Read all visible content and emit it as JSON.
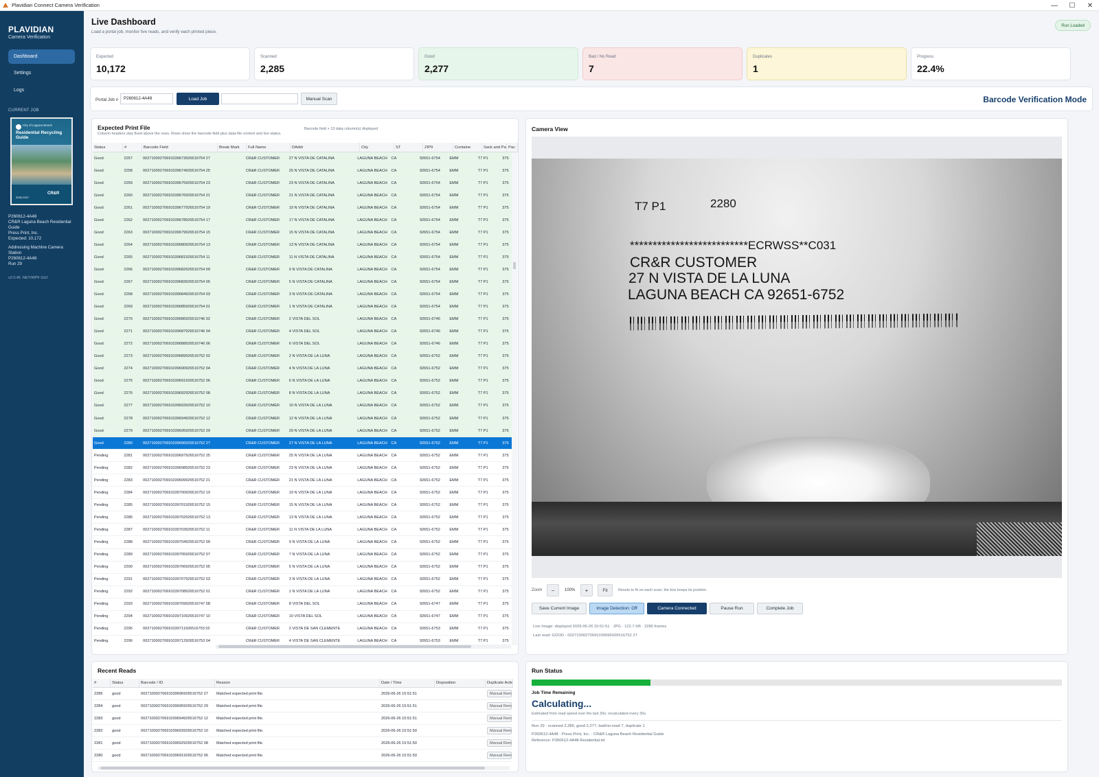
{
  "window": {
    "title": "Plavidian Connect Camera Verification",
    "controls": [
      "—",
      "☐",
      "✕"
    ]
  },
  "sidebar": {
    "brand": "PLAVIDIAN",
    "brand_sub": "Camera Verification",
    "nav": [
      {
        "label": "Dashboard"
      },
      {
        "label": "Settings"
      },
      {
        "label": "Logs"
      }
    ],
    "current_job_heading": "CURRENT JOB",
    "thumb": {
      "city": "City of Laguna Beach",
      "title": "Residential Recycling Guide",
      "years": "2026-2027",
      "crr": "CR&R"
    },
    "job_lines": [
      "P260612-4A48",
      "CR&R Laguna Beach Residential",
      "Guide",
      "Press Print, Inc.",
      "Expected: 10,172"
    ],
    "station_lines": [
      "Addressing Machine Camera",
      "Station",
      "P260612-4A48",
      "Run 29"
    ],
    "version": "v2.0.45 .NET/WPF GUI"
  },
  "header": {
    "title": "Live Dashboard",
    "subtitle": "Load a portal job, monitor live reads, and verify each printed piece.",
    "badge": "Run Loaded"
  },
  "stats": [
    {
      "label": "Expected",
      "value": "10,172",
      "bg": "#ffffff",
      "border": "#dfe3e8"
    },
    {
      "label": "Scanned",
      "value": "2,285",
      "bg": "#ffffff",
      "border": "#dfe3e8"
    },
    {
      "label": "Good",
      "value": "2,277",
      "bg": "#e7f6ea",
      "border": "#cfe8d5"
    },
    {
      "label": "Bad / No Read",
      "value": "7",
      "bg": "#fbe6e6",
      "border": "#f0cccc"
    },
    {
      "label": "Duplicates",
      "value": "1",
      "bg": "#fdf6d8",
      "border": "#ede0a8"
    },
    {
      "label": "Progress",
      "value": "22.4%",
      "bg": "#ffffff",
      "border": "#dfe3e8"
    }
  ],
  "job_bar": {
    "label": "Portal Job #",
    "job_value": "P260612-4A48",
    "load_label": "Load Job",
    "manual_value": "",
    "manual_scan_label": "Manual Scan",
    "mode": "Barcode Verification Mode"
  },
  "print_file": {
    "title": "Expected Print File",
    "subtitle": "Column headers stay fixed above the rows. Rows show the barcode field plus data-file context and live status.",
    "meta": "Barcode field + 13 data column(s) displayed",
    "columns": [
      "Status",
      "#",
      "Barcode Field",
      "Break Mark",
      "Full Name",
      "DAddr",
      "City",
      "ST",
      "ZIP9",
      "Containe",
      "Sack and Pa",
      "Pac"
    ],
    "rows": [
      [
        "Good",
        "2257",
        "00271000270691039673926516754 27",
        "",
        "CR&R CUSTOMER",
        "27 N VISTA DE CATALINA",
        "LAGUNA BEACH",
        "CA",
        "92651-6754",
        "EMM",
        "T7  P1",
        "375"
      ],
      [
        "Good",
        "2258",
        "00271000270691039674926516754 25",
        "",
        "CR&R CUSTOMER",
        "25 N VISTA DE CATALINA",
        "LAGUNA BEACH",
        "CA",
        "92651-6754",
        "EMM",
        "T7  P1",
        "375"
      ],
      [
        "Good",
        "2259",
        "00271000270691039675926516754 23",
        "",
        "CR&R CUSTOMER",
        "23 N VISTA DE CATALINA",
        "LAGUNA BEACH",
        "CA",
        "92651-6754",
        "EMM",
        "T7  P1",
        "375"
      ],
      [
        "Good",
        "2260",
        "00271000270691039676926516754 21",
        "",
        "CR&R CUSTOMER",
        "21 N VISTA DE CATALINA",
        "LAGUNA BEACH",
        "CA",
        "92651-6754",
        "EMM",
        "T7  P1",
        "375"
      ],
      [
        "Good",
        "2261",
        "00271000270691039677926516754 19",
        "",
        "CR&R CUSTOMER",
        "19 N VISTA DE CATALINA",
        "LAGUNA BEACH",
        "CA",
        "92651-6754",
        "EMM",
        "T7  P1",
        "375"
      ],
      [
        "Good",
        "2262",
        "00271000270691039678926516754 17",
        "",
        "CR&R CUSTOMER",
        "17 N VISTA DE CATALINA",
        "LAGUNA BEACH",
        "CA",
        "92651-6754",
        "EMM",
        "T7  P1",
        "375"
      ],
      [
        "Good",
        "2263",
        "00271000270691039679926516754 15",
        "",
        "CR&R CUSTOMER",
        "15 N VISTA DE CATALINA",
        "LAGUNA BEACH",
        "CA",
        "92651-6754",
        "EMM",
        "T7  P1",
        "375"
      ],
      [
        "Good",
        "2264",
        "00271000270691039680926516754 13",
        "",
        "CR&R CUSTOMER",
        "13 N VISTA DE CATALINA",
        "LAGUNA BEACH",
        "CA",
        "92651-6754",
        "EMM",
        "T7  P1",
        "375"
      ],
      [
        "Good",
        "2265",
        "00271000270691039681926516754 11",
        "",
        "CR&R CUSTOMER",
        "11 N VISTA DE CATALINA",
        "LAGUNA BEACH",
        "CA",
        "92651-6754",
        "EMM",
        "T7  P1",
        "375"
      ],
      [
        "Good",
        "2266",
        "00271000270691039682926516754 09",
        "",
        "CR&R CUSTOMER",
        "9 N VISTA DE CATALINA",
        "LAGUNA BEACH",
        "CA",
        "92651-6754",
        "EMM",
        "T7  P1",
        "375"
      ],
      [
        "Good",
        "2267",
        "00271000270691039683926516754 05",
        "",
        "CR&R CUSTOMER",
        "5 N VISTA DE CATALINA",
        "LAGUNA BEACH",
        "CA",
        "92651-6754",
        "EMM",
        "T7  P1",
        "375"
      ],
      [
        "Good",
        "2268",
        "00271000270691039684926516754 03",
        "",
        "CR&R CUSTOMER",
        "3 N VISTA DE CATALINA",
        "LAGUNA BEACH",
        "CA",
        "92651-6754",
        "EMM",
        "T7  P1",
        "375"
      ],
      [
        "Good",
        "2269",
        "00271000270691039685926516754 01",
        "",
        "CR&R CUSTOMER",
        "1 N VISTA DE CATALINA",
        "LAGUNA BEACH",
        "CA",
        "92651-6754",
        "EMM",
        "T7  P1",
        "375"
      ],
      [
        "Good",
        "2270",
        "00271000270691039686926516746 02",
        "",
        "CR&R CUSTOMER",
        "2 VISTA DEL SOL",
        "LAGUNA BEACH",
        "CA",
        "92651-6746",
        "EMM",
        "T7  P1",
        "375"
      ],
      [
        "Good",
        "2271",
        "00271000270691039687926516746 04",
        "",
        "CR&R CUSTOMER",
        "4 VISTA DEL SOL",
        "LAGUNA BEACH",
        "CA",
        "92651-6746",
        "EMM",
        "T7  P1",
        "375"
      ],
      [
        "Good",
        "2272",
        "00271000270691039688926516746 06",
        "",
        "CR&R CUSTOMER",
        "6 VISTA DEL SOL",
        "LAGUNA BEACH",
        "CA",
        "92651-6746",
        "EMM",
        "T7  P1",
        "375"
      ],
      [
        "Good",
        "2273",
        "00271000270691039689926516752 02",
        "",
        "CR&R CUSTOMER",
        "2 N VISTA DE LA LUNA",
        "LAGUNA BEACH",
        "CA",
        "92651-6752",
        "EMM",
        "T7  P1",
        "375"
      ],
      [
        "Good",
        "2274",
        "00271000270691039690926516752 04",
        "",
        "CR&R CUSTOMER",
        "4 N VISTA DE LA LUNA",
        "LAGUNA BEACH",
        "CA",
        "92651-6752",
        "EMM",
        "T7  P1",
        "375"
      ],
      [
        "Good",
        "2275",
        "00271000270691039691926516752 06",
        "",
        "CR&R CUSTOMER",
        "6 N VISTA DE LA LUNA",
        "LAGUNA BEACH",
        "CA",
        "92651-6752",
        "EMM",
        "T7  P1",
        "375"
      ],
      [
        "Good",
        "2276",
        "00271000270691039692926516752 08",
        "",
        "CR&R CUSTOMER",
        "8 N VISTA DE LA LUNA",
        "LAGUNA BEACH",
        "CA",
        "92651-6752",
        "EMM",
        "T7  P1",
        "375"
      ],
      [
        "Good",
        "2277",
        "00271000270691039693926516752 10",
        "",
        "CR&R CUSTOMER",
        "10 N VISTA DE LA LUNA",
        "LAGUNA BEACH",
        "CA",
        "92651-6752",
        "EMM",
        "T7  P1",
        "375"
      ],
      [
        "Good",
        "2278",
        "00271000270691039694926516752 12",
        "",
        "CR&R CUSTOMER",
        "12 N VISTA DE LA LUNA",
        "LAGUNA BEACH",
        "CA",
        "92651-6752",
        "EMM",
        "T7  P1",
        "375"
      ],
      [
        "Good",
        "2279",
        "00271000270691039695926516752 29",
        "",
        "CR&R CUSTOMER",
        "29 N VISTA DE LA LUNA",
        "LAGUNA BEACH",
        "CA",
        "92651-6752",
        "EMM",
        "T7  P1",
        "375"
      ],
      [
        "Good",
        "2280",
        "00271000270691039696926516752 27",
        "",
        "CR&R CUSTOMER",
        "27 N VISTA DE LA LUNA",
        "LAGUNA BEACH",
        "CA",
        "92651-6752",
        "EMM",
        "T7  P1",
        "375"
      ],
      [
        "Pending",
        "2281",
        "00271000270691039697926516752 25",
        "",
        "CR&R CUSTOMER",
        "25 N VISTA DE LA LUNA",
        "LAGUNA BEACH",
        "CA",
        "92651-6752",
        "EMM",
        "T7  P1",
        "375"
      ],
      [
        "Pending",
        "2282",
        "00271000270691039698926516752 23",
        "",
        "CR&R CUSTOMER",
        "23 N VISTA DE LA LUNA",
        "LAGUNA BEACH",
        "CA",
        "92651-6752",
        "EMM",
        "T7  P1",
        "375"
      ],
      [
        "Pending",
        "2283",
        "00271000270691039699926516752 21",
        "",
        "CR&R CUSTOMER",
        "21 N VISTA DE LA LUNA",
        "LAGUNA BEACH",
        "CA",
        "92651-6752",
        "EMM",
        "T7  P1",
        "375"
      ],
      [
        "Pending",
        "2284",
        "00271000270691039700926516752 19",
        "",
        "CR&R CUSTOMER",
        "19 N VISTA DE LA LUNA",
        "LAGUNA BEACH",
        "CA",
        "92651-6752",
        "EMM",
        "T7  P1",
        "375"
      ],
      [
        "Pending",
        "2285",
        "00271000270691039701926516752 15",
        "",
        "CR&R CUSTOMER",
        "15 N VISTA DE LA LUNA",
        "LAGUNA BEACH",
        "CA",
        "92651-6752",
        "EMM",
        "T7  P1",
        "375"
      ],
      [
        "Pending",
        "2286",
        "00271000270691039702926516752 13",
        "",
        "CR&R CUSTOMER",
        "13 N VISTA DE LA LUNA",
        "LAGUNA BEACH",
        "CA",
        "92651-6752",
        "EMM",
        "T7  P1",
        "375"
      ],
      [
        "Pending",
        "2287",
        "00271000270691039703926516752 11",
        "",
        "CR&R CUSTOMER",
        "11 N VISTA DE LA LUNA",
        "LAGUNA BEACH",
        "CA",
        "92651-6752",
        "EMM",
        "T7  P1",
        "375"
      ],
      [
        "Pending",
        "2288",
        "00271000270691039704926516752 09",
        "",
        "CR&R CUSTOMER",
        "9 N VISTA DE LA LUNA",
        "LAGUNA BEACH",
        "CA",
        "92651-6752",
        "EMM",
        "T7  P1",
        "375"
      ],
      [
        "Pending",
        "2289",
        "00271000270691039705926516752 07",
        "",
        "CR&R CUSTOMER",
        "7 N VISTA DE LA LUNA",
        "LAGUNA BEACH",
        "CA",
        "92651-6752",
        "EMM",
        "T7  P1",
        "375"
      ],
      [
        "Pending",
        "2290",
        "00271000270691039706926516752 05",
        "",
        "CR&R CUSTOMER",
        "5 N VISTA DE LA LUNA",
        "LAGUNA BEACH",
        "CA",
        "92651-6752",
        "EMM",
        "T7  P1",
        "375"
      ],
      [
        "Pending",
        "2291",
        "00271000270691039707926516752 03",
        "",
        "CR&R CUSTOMER",
        "3 N VISTA DE LA LUNA",
        "LAGUNA BEACH",
        "CA",
        "92651-6752",
        "EMM",
        "T7  P1",
        "375"
      ],
      [
        "Pending",
        "2292",
        "00271000270691039708926516752 01",
        "",
        "CR&R CUSTOMER",
        "1 N VISTA DE LA LUNA",
        "LAGUNA BEACH",
        "CA",
        "92651-6752",
        "EMM",
        "T7  P1",
        "375"
      ],
      [
        "Pending",
        "2293",
        "00271000270691039709926516747 08",
        "",
        "CR&R CUSTOMER",
        "8 VISTA DEL SOL",
        "LAGUNA BEACH",
        "CA",
        "92651-6747",
        "EMM",
        "T7  P1",
        "375"
      ],
      [
        "Pending",
        "2294",
        "00271000270691039710926516747 10",
        "",
        "CR&R CUSTOMER",
        "10 VISTA DEL SOL",
        "LAGUNA BEACH",
        "CA",
        "92651-6747",
        "EMM",
        "T7  P1",
        "375"
      ],
      [
        "Pending",
        "2295",
        "00271000270691039711926516753 02",
        "",
        "CR&R CUSTOMER",
        "2 VISTA DE SAN CLEMENTE",
        "LAGUNA BEACH",
        "CA",
        "92651-6753",
        "EMM",
        "T7  P1",
        "375"
      ],
      [
        "Pending",
        "2296",
        "00271000270691039712926516753 04",
        "",
        "CR&R CUSTOMER",
        "4 VISTA DE SAN CLEMENTE",
        "LAGUNA BEACH",
        "CA",
        "92651-6753",
        "EMM",
        "T7  P1",
        "375"
      ]
    ],
    "selected_number": "2280"
  },
  "recent_reads": {
    "title": "Recent Reads",
    "columns": [
      "#",
      "Status",
      "Barcode / ID",
      "Reason",
      "Date / Time",
      "Disposition",
      "Duplicate Actic"
    ],
    "action_label": "Manual Rem",
    "rows": [
      [
        "2285",
        "good",
        "00271000270691039696926516752 27",
        "Matched expected print file.",
        "2026-06-26 15:51:51",
        ""
      ],
      [
        "2284",
        "good",
        "00271000270691039695926516752 29",
        "Matched expected print file.",
        "2026-06-26 15:51:51",
        ""
      ],
      [
        "2283",
        "good",
        "00271000270691039694926516752 12",
        "Matched expected print file.",
        "2026-06-26 15:51:51",
        ""
      ],
      [
        "2282",
        "good",
        "00271000270691039693926516752 10",
        "Matched expected print file.",
        "2026-06-26 15:51:50",
        ""
      ],
      [
        "2281",
        "good",
        "00271000270691039692926516752 08",
        "Matched expected print file.",
        "2026-06-26 15:51:50",
        ""
      ],
      [
        "2280",
        "good",
        "00271000270691039691926516752 06",
        "Matched expected print file.",
        "2026-06-26 15:51:50",
        ""
      ]
    ]
  },
  "camera": {
    "title": "Camera View",
    "label_line1_left": "T7  P1",
    "label_line1_right": "2280",
    "label_stars": "**************************ECRWSS**C031",
    "label_name": "CR&R CUSTOMER",
    "label_addr": "27 N VISTA DE LA LUNA",
    "label_city": "LAGUNA BEACH  CA 92651-6752",
    "zoom_label": "Zoom",
    "zoom_minus": "−",
    "zoom_value": "100%",
    "zoom_plus": "+",
    "fit_label": "Fit",
    "zoom_hint": "Resets to fit on each scan; the box keeps its position.",
    "save_label": "Save Current Image",
    "detection_label": "Image Detection: Off",
    "connected_label": "Camera Connected",
    "pause_label": "Pause Run",
    "complete_label": "Complete Job",
    "live_image": "Live Image: displayed 2026-06-26 15:51:51 · JPG · 122.7 KB · 2280 frames",
    "last_read": "Last read: GOOD - 00271000270691039696926516752 27"
  },
  "run_status": {
    "title": "Run Status",
    "progress_fraction": 0.224,
    "time_label": "Job Time Remaining",
    "time_value": "Calculating...",
    "estimate_note": "Estimated from read speed over the last 30s; recalculated every 30s.",
    "summary": "Run 29 · scanned 2,285, good 2,277, bad/no-read 7, duplicate 1",
    "job_line": "P260612-4A48 · Press Print, Inc. · CR&R Laguna Beach Residential Guide",
    "reference": "Reference: P260612-4A48 Residential.txt"
  },
  "colors": {
    "sidebar": "#123e62",
    "primary": "#163e6b",
    "good_row": "#e8f6ea",
    "selected_row": "#0c78d6",
    "progress": "#17b03b"
  }
}
